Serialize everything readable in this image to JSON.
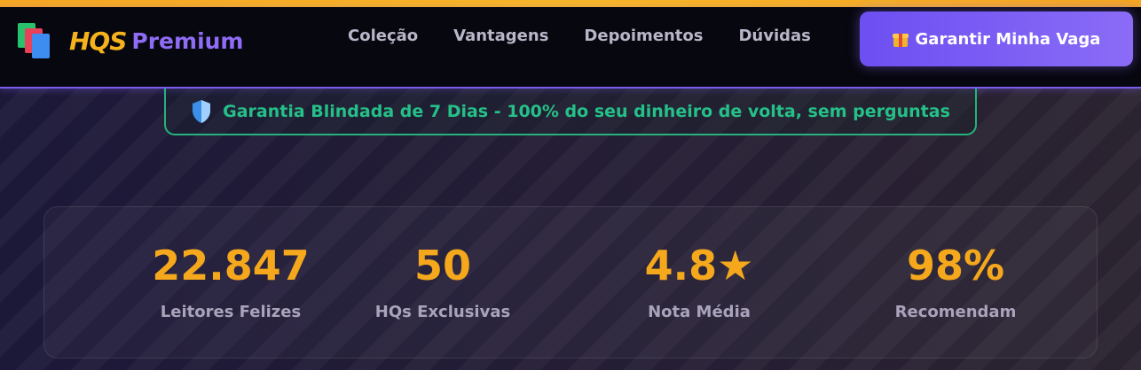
{
  "brand": {
    "logo_icon": "colored-books-icon",
    "hqs": "HQS",
    "premium": "Premium",
    "colors": {
      "hqs": "#f5b21c",
      "premium": "#8f6cf5"
    }
  },
  "nav": {
    "links": [
      "Coleção",
      "Vantagens",
      "Depoimentos",
      "Dúvidas"
    ]
  },
  "cta": {
    "icon": "gift-icon",
    "label": "Garantir Minha Vaga",
    "color": "#7a5cf0"
  },
  "guarantee": {
    "icon": "shield-icon",
    "text": "Garantia Blindada de 7 Dias - 100% do seu dinheiro de volta, sem perguntas",
    "color": "#25c088"
  },
  "stats": [
    {
      "value": "22.847",
      "label": "Leitores Felizes"
    },
    {
      "value": "50",
      "label": "HQs Exclusivas"
    },
    {
      "value": "4.8★",
      "label": "Nota Média"
    },
    {
      "value": "98%",
      "label": "Recomendam"
    }
  ],
  "theme": {
    "accent_yellow": "#f5a81c",
    "navbar_bg": "#07070f",
    "page_bg": "#1c1838"
  }
}
